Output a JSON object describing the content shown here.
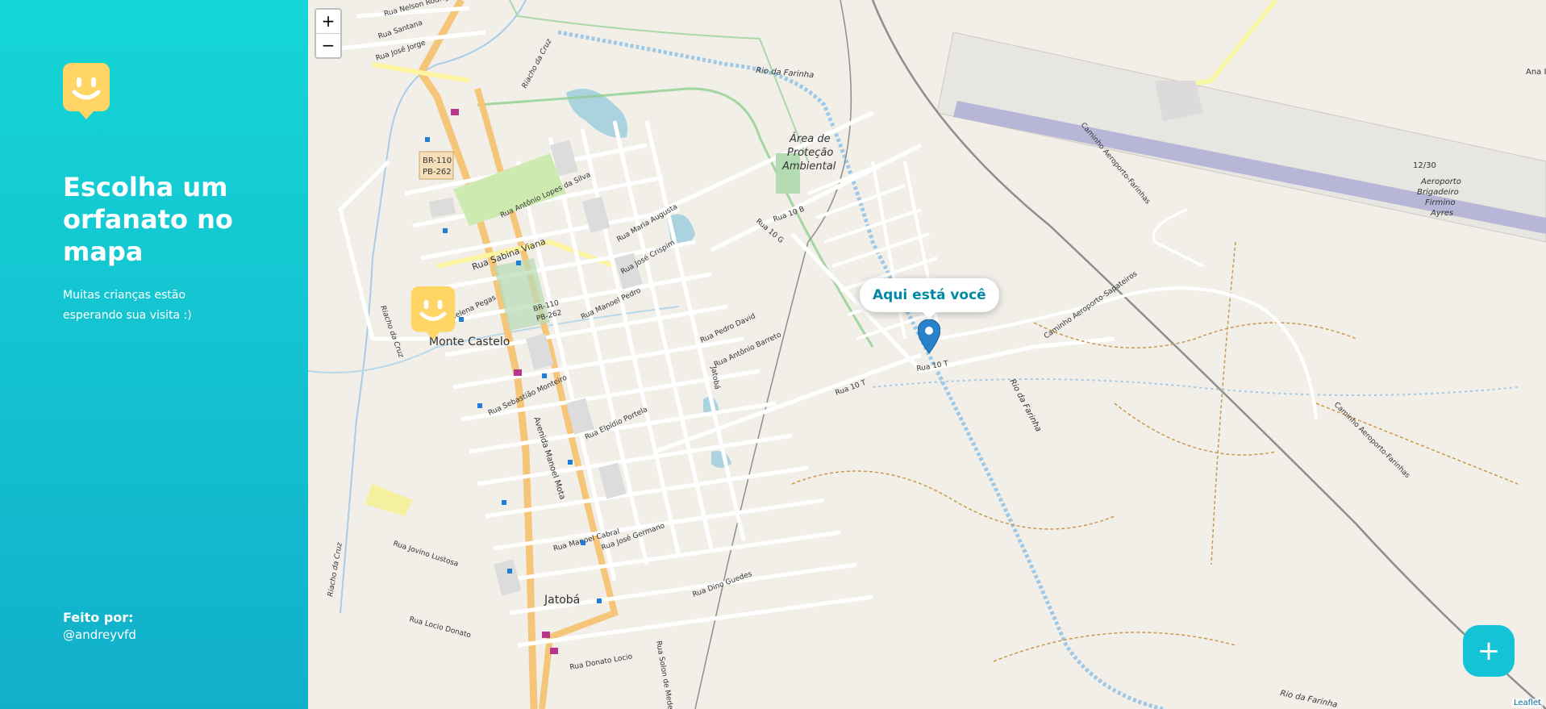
{
  "sidebar": {
    "title": "Escolha um orfanato no mapa",
    "subtitle": "Muitas crianças estão esperando sua visita :)",
    "credit_label": "Feito por:",
    "credit_handle": "@andreyvfd",
    "brand_color": "#15c3d6",
    "logo_color": "#ffd666"
  },
  "map": {
    "zoom_in": "+",
    "zoom_out": "−",
    "popup_text": "Aqui está você",
    "add_button": "+",
    "attribution": "Leaflet",
    "labels": {
      "monte_castelo": "Monte Castelo",
      "jatoba": "Jatobá",
      "area_protecao_1": "Área de",
      "area_protecao_2": "Proteção",
      "area_protecao_3": "Ambiental",
      "rio_farinha": "Rio da Farinha",
      "rio_farinha_2": "Rio da Farinha",
      "rio_farinha_3": "Rio da Farinha",
      "riacho_cruz": "Riacho da Cruz",
      "riacho_cruz_2": "Riacho da Cruz",
      "riacho_cruz_3": "Riacho da Cruz",
      "br110": "BR-110",
      "pb262": "PB-262",
      "br110b": "BR-110",
      "pb262b": "PB-262",
      "rua_sabina": "Rua Sabina Viana",
      "av_manoel_mota": "Avenida Manoel Mota",
      "rua_10t": "Rua 10 T",
      "rua_10t_2": "Rua 10 T",
      "rua_10g": "Rua 10 G",
      "rua_10b": "Rua 10 B",
      "caminho_sap": "Caminho Aeroporto-Sapateiros",
      "caminho_far": "Caminho Aeroporto-Farinhas",
      "caminho_far_2": "Caminho Aeroporto-Farinhas",
      "aeroporto_1": "Aeroporto",
      "aeroporto_2": "Brigadeiro",
      "aeroporto_3": "Firmino",
      "aeroporto_4": "Ayres",
      "pista": "12/30",
      "rua_jovino": "Rua Jovino Lustosa",
      "rua_locio": "Rua Locio Donato",
      "rua_manoel_pedro": "Rua Manoel Pedro",
      "rua_pedro_david": "Rua Pedro David",
      "rua_antonio_barreto": "Rua Antônio Barreto",
      "rua_helena": "Rua Helena Pegas",
      "rua_sebastiao": "Rua Sebastião Monteiro",
      "rua_jose_jorge": "Rua José Jorge",
      "rua_santana": "Rua Santana",
      "rua_nelson": "Rua Nelson Rodrigues",
      "rua_solon": "Rua Solon de Medeiros",
      "rua_dino": "Rua Dino Guedes",
      "rua_jose_germano": "Rua José Germano",
      "rua_donato_locio": "Rua Donato Locio",
      "rua_manoel_cabral": "Rua Manoel Cabral",
      "rua_elpidio": "Rua Elpídio Portela",
      "rua_antonio_lopes": "Rua Antônio Lopes da Silva",
      "rua_jose_crispim": "Rua José Crispim",
      "rua_maria_augusta": "Rua Maria Augusta",
      "jatoba_creek": "Jatobá",
      "ana": "Ana I"
    }
  }
}
